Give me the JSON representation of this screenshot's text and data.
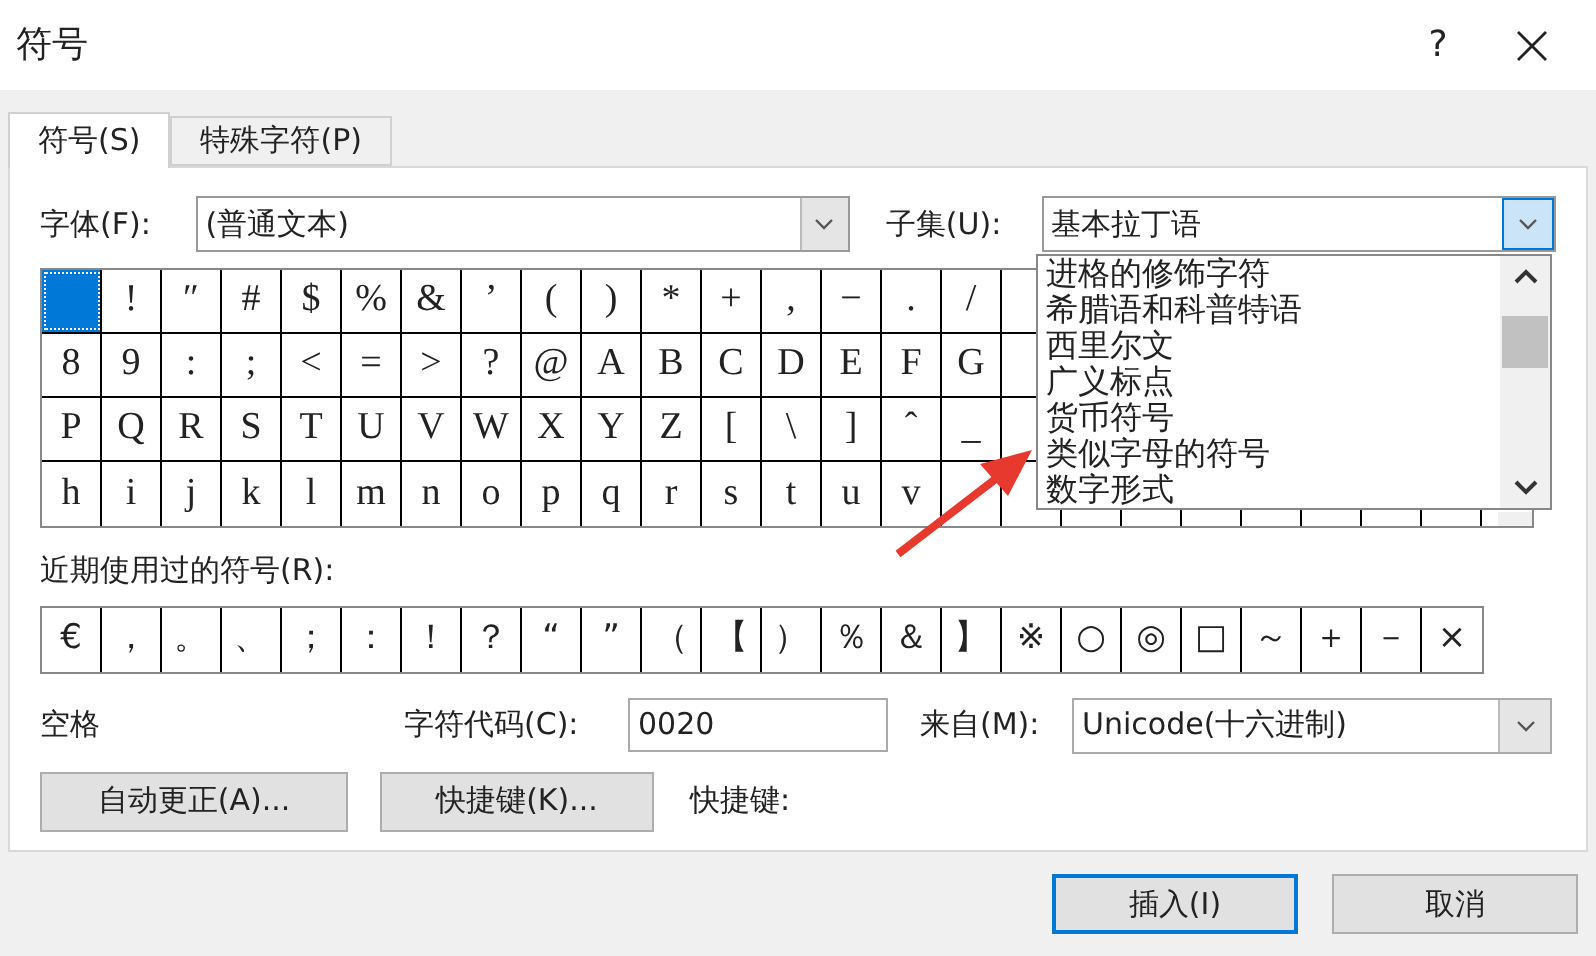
{
  "window": {
    "title": "符号",
    "help": "?"
  },
  "tabs": [
    {
      "label": "符号(S)",
      "selected": true
    },
    {
      "label": "特殊字符(P)",
      "selected": false
    }
  ],
  "font": {
    "label": "字体(F):",
    "value": "(普通文本)"
  },
  "subset": {
    "label": "子集(U):",
    "value": "基本拉丁语",
    "expanded": true,
    "options": [
      "进格的修饰字符",
      "希腊语和科普特语",
      "西里尔文",
      "广义标点",
      "货币符号",
      "类似字母的符号",
      "数字形式"
    ]
  },
  "symbol_grid": {
    "rows": [
      [
        {
          "selected": true
        },
        {
          "char": "!",
          "selected": false
        },
        {
          "char": "″",
          "selected": false
        },
        {
          "char": "#",
          "selected": false
        },
        {
          "char": "$",
          "selected": false
        },
        {
          "char": "%",
          "selected": false
        },
        {
          "char": "&",
          "selected": false
        },
        {
          "char": "’",
          "selected": false
        },
        {
          "char": "(",
          "selected": false
        },
        {
          "char": ")",
          "selected": false
        },
        {
          "char": "*",
          "selected": false
        },
        {
          "char": "+",
          "selected": false
        },
        {
          "char": ",",
          "selected": false
        },
        {
          "char": "−",
          "selected": false
        },
        {
          "char": ".",
          "selected": false
        },
        {
          "char": "/",
          "selected": false
        }
      ],
      [
        {
          "char": "8",
          "selected": false
        },
        {
          "char": "9",
          "selected": false
        },
        {
          "char": ":",
          "selected": false
        },
        {
          "char": ";",
          "selected": false
        },
        {
          "char": "<",
          "selected": false
        },
        {
          "char": "=",
          "selected": false
        },
        {
          "char": ">",
          "selected": false
        },
        {
          "char": "?",
          "selected": false
        },
        {
          "char": "@",
          "selected": false
        },
        {
          "char": "A",
          "selected": false
        },
        {
          "char": "B",
          "selected": false
        },
        {
          "char": "C",
          "selected": false
        },
        {
          "char": "D",
          "selected": false
        },
        {
          "char": "E",
          "selected": false
        },
        {
          "char": "F",
          "selected": false
        },
        {
          "char": "G",
          "selected": false
        }
      ],
      [
        {
          "char": "P",
          "selected": false
        },
        {
          "char": "Q",
          "selected": false
        },
        {
          "char": "R",
          "selected": false
        },
        {
          "char": "S",
          "selected": false
        },
        {
          "char": "T",
          "selected": false
        },
        {
          "char": "U",
          "selected": false
        },
        {
          "char": "V",
          "selected": false
        },
        {
          "char": "W",
          "selected": false
        },
        {
          "char": "X",
          "selected": false
        },
        {
          "char": "Y",
          "selected": false
        },
        {
          "char": "Z",
          "selected": false
        },
        {
          "char": "[",
          "selected": false
        },
        {
          "char": "\\",
          "selected": false
        },
        {
          "char": "]",
          "selected": false
        },
        {
          "char": "ˆ",
          "selected": false
        },
        {
          "char": "_",
          "selected": false
        }
      ],
      [
        {
          "char": "h",
          "selected": false
        },
        {
          "char": "i",
          "selected": false
        },
        {
          "char": "j",
          "selected": false
        },
        {
          "char": "k",
          "selected": false
        },
        {
          "char": "l",
          "selected": false
        },
        {
          "char": "m",
          "selected": false
        },
        {
          "char": "n",
          "selected": false
        },
        {
          "char": "o",
          "selected": false
        },
        {
          "char": "p",
          "selected": false
        },
        {
          "char": "q",
          "selected": false
        },
        {
          "char": "r",
          "selected": false
        },
        {
          "char": "s",
          "selected": false
        },
        {
          "char": "t",
          "selected": false
        },
        {
          "char": "u",
          "selected": false
        },
        {
          "char": "v",
          "selected": false
        }
      ]
    ]
  },
  "recent": {
    "label": "近期使用过的符号(R):",
    "symbols": [
      "€",
      "，",
      "。",
      "、",
      "；",
      "：",
      "！",
      "？",
      "“",
      "”",
      "（",
      "【",
      "）",
      "％",
      "＆",
      "】",
      "※",
      "○",
      "◎",
      "□",
      "～",
      "＋",
      "－",
      "×"
    ]
  },
  "char_name": "空格",
  "char_code": {
    "label": "字符代码(C):",
    "value": "0020"
  },
  "from": {
    "label": "来自(M):",
    "value": "Unicode(十六进制)"
  },
  "actions": {
    "autocorrect": "自动更正(A)...",
    "shortcut_key": "快捷键(K)...",
    "shortcut_label": "快捷键:"
  },
  "buttons": [
    {
      "label": "插入(I)",
      "default": true
    },
    {
      "label": "取消",
      "default": false
    }
  ]
}
